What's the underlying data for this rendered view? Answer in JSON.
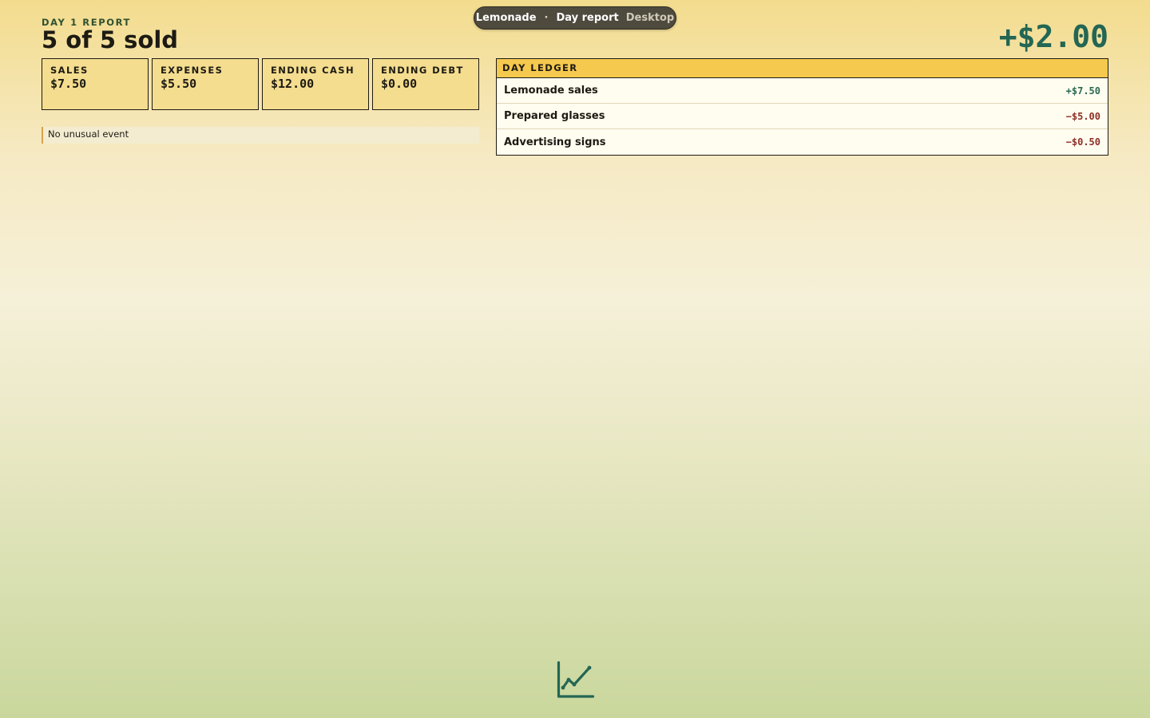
{
  "app": {
    "name": "Lemonade",
    "separator": "·",
    "screen": "Day report",
    "mode": "Desktop"
  },
  "header": {
    "kicker": "DAY 1 REPORT",
    "title": "5 of 5 sold",
    "net": "+$2.00"
  },
  "stats": [
    {
      "label": "SALES",
      "value": "$7.50"
    },
    {
      "label": "EXPENSES",
      "value": "$5.50"
    },
    {
      "label": "ENDING CASH",
      "value": "$12.00"
    },
    {
      "label": "ENDING DEBT",
      "value": "$0.00"
    }
  ],
  "event": "No unusual event",
  "ledger": {
    "title": "DAY LEDGER",
    "rows": [
      {
        "name": "Lemonade sales",
        "amount": "+$7.50",
        "kind": "pos"
      },
      {
        "name": "Prepared glasses",
        "amount": "−$5.00",
        "kind": "neg"
      },
      {
        "name": "Advertising signs",
        "amount": "−$0.50",
        "kind": "neg"
      }
    ]
  },
  "colors": {
    "positive": "#236654",
    "negative": "#8e2f26",
    "accent": "#f5c94e"
  },
  "icons": {
    "footer": "line-chart-icon"
  }
}
